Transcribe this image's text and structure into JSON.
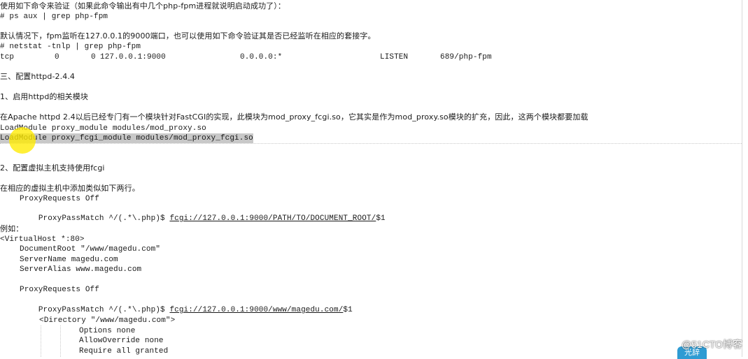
{
  "document": {
    "line1": "使用如下命令来验证（如果此命令输出有中几个php-fpm进程就说明启动成功了）：",
    "line2": "# ps aux | grep php-fpm",
    "line3": "默认情况下，fpm监听在127.0.0.1的9000端口，也可以使用如下命令验证其是否已经监听在相应的套接字。",
    "line4": "# netstat -tnlp | grep php-fpm",
    "netstat_row": {
      "proto": "tcp",
      "recvq": "0",
      "sendq": "0",
      "local": "127.0.0.1:9000",
      "foreign": "0.0.0.0:*",
      "state": "LISTEN",
      "pid": "689/php-fpm"
    },
    "section3": "三、配置httpd-2.4.4",
    "step1": "1、启用httpd的相关模块",
    "apache_note": "在Apache httpd 2.4以后已经专门有一个模块针对FastCGI的实现，此模块为mod_proxy_fcgi.so，它其实是作为mod_proxy.so模块的扩充，因此，这两个模块都要加载",
    "load1": "LoadModule proxy_module modules/mod_proxy.so",
    "load2": "LoadModule proxy_fcgi_module modules/mod_proxy_fcgi.so",
    "step2": "2、配置虚拟主机支持使用fcgi",
    "vhost_note": "在相应的虚拟主机中添加类似如下两行。",
    "pr1": "ProxyRequests Off",
    "ppm1_prefix": "ProxyPassMatch ^/(.*\\.php)$ ",
    "ppm1_url": "fcgi://127.0.0.1:9000/PATH/TO/DOCUMENT_ROOT/",
    "ppm1_suffix": "$1",
    "example": "例如：",
    "vh_open": "<VirtualHost *:80>",
    "docroot": "DocumentRoot \"/www/magedu.com\"",
    "servername": "ServerName magedu.com",
    "serveralias": "ServerAlias www.magedu.com",
    "pr2": "ProxyRequests Off",
    "ppm2_prefix": "ProxyPassMatch ^/(.*\\.php)$ ",
    "ppm2_url": "fcgi://127.0.0.1:9000/www/magedu.com/",
    "ppm2_suffix": "$1",
    "dir_open": "<Directory \"/www/magedu.com\">",
    "options": "Options none",
    "allowoverride": "AllowOverride none",
    "require": "Require all granted"
  },
  "watermark": "@51CTO博客",
  "badge": "光辞",
  "colors": {
    "highlight": "#c8c8c8",
    "cursor": "#ffeb00",
    "badge": "#2e9bd3"
  }
}
